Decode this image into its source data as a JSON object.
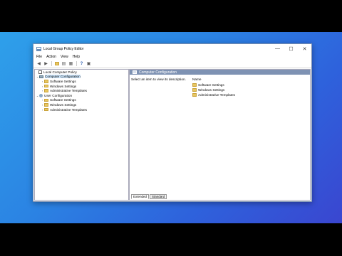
{
  "window": {
    "title": "Local Group Policy Editor",
    "min": "—",
    "max": "☐",
    "close": "✕"
  },
  "menu": [
    "File",
    "Action",
    "View",
    "Help"
  ],
  "tree": {
    "root": "Local Computer Policy",
    "computer": "Computer Configuration",
    "computer_children": [
      "Software Settings",
      "Windows Settings",
      "Administrative Templates"
    ],
    "user": "User Configuration",
    "user_children": [
      "Software Settings",
      "Windows Settings",
      "Administrative Templates"
    ]
  },
  "right": {
    "header": "Computer Configuration",
    "description": "Select an item to view its description.",
    "column_name": "Name",
    "items": [
      "Software Settings",
      "Windows Settings",
      "Administrative Templates"
    ]
  },
  "tabs": [
    "Extended",
    "Standard"
  ]
}
